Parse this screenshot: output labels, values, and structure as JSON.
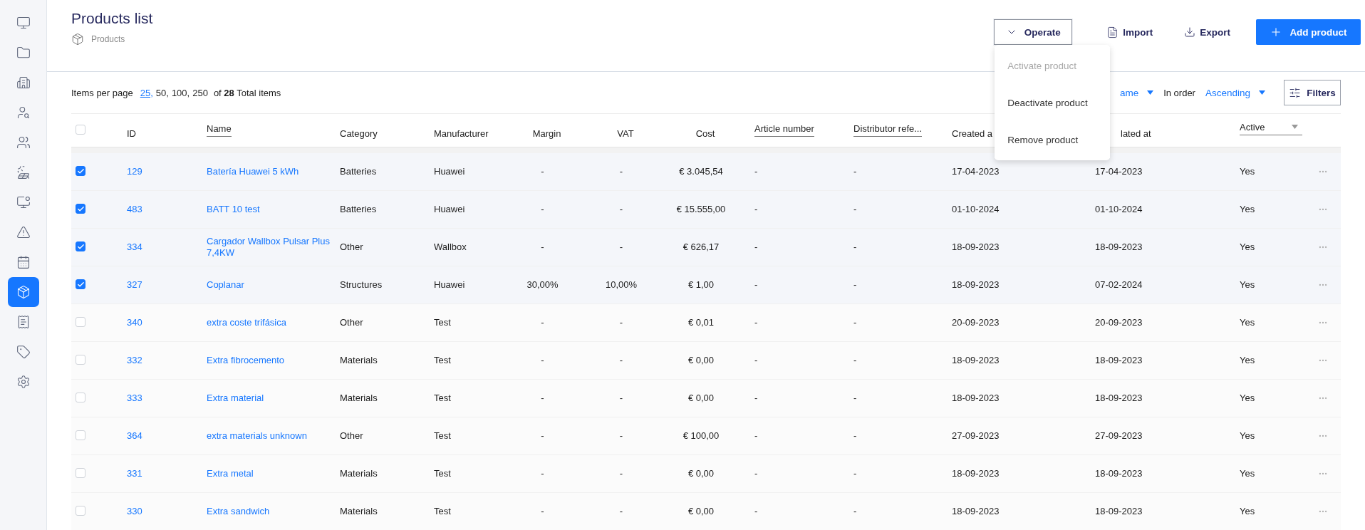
{
  "sidebar": {
    "items": [
      {
        "selected": false
      },
      {
        "selected": false
      },
      {
        "selected": false
      },
      {
        "selected": false
      },
      {
        "selected": false
      },
      {
        "selected": false
      },
      {
        "selected": false
      },
      {
        "selected": false
      },
      {
        "selected": false
      },
      {
        "selected": true
      },
      {
        "selected": false
      },
      {
        "selected": false
      },
      {
        "selected": false
      }
    ]
  },
  "header": {
    "title": "Products list",
    "breadcrumb": "Products",
    "operate": {
      "label": "Operate",
      "expanded": true,
      "menu": [
        {
          "label": "Activate product",
          "disabled": true
        },
        {
          "label": "Deactivate product",
          "disabled": false
        },
        {
          "label": "Remove product",
          "disabled": false
        }
      ]
    },
    "import": "Import",
    "export": "Export",
    "add": "Add product"
  },
  "toolbar": {
    "items_per_page_label": "Items per page",
    "page_sizes": [
      {
        "label": "25,",
        "selected": true
      },
      {
        "label": "50,",
        "selected": false
      },
      {
        "label": "100,",
        "selected": false
      },
      {
        "label": "250",
        "selected": false
      }
    ],
    "total": "of **28** Total items",
    "sort_value": "ame",
    "order_label": "In order",
    "order_value": "Ascending",
    "filters": "Filters"
  },
  "table": {
    "all_checked": false,
    "columns": [
      {
        "label": "ID",
        "kind": "plain"
      },
      {
        "label": "Name",
        "kind": "filter"
      },
      {
        "label": "Category",
        "kind": "plain"
      },
      {
        "label": "Manufacturer",
        "kind": "plain"
      },
      {
        "label": "Margin",
        "kind": "centered"
      },
      {
        "label": "VAT",
        "kind": "centered"
      },
      {
        "label": "Cost",
        "kind": "centered"
      },
      {
        "label": "Article number",
        "kind": "filter"
      },
      {
        "label": "Distributor refe...",
        "kind": "filter"
      },
      {
        "label": "Created a",
        "kind": "plain"
      },
      {
        "label": "lated at",
        "kind": "plain"
      },
      {
        "label": "Active",
        "kind": "select"
      }
    ],
    "rows": [
      {
        "selected": true,
        "cells": [
          "129",
          "Batería Huawei 5 kWh",
          "Batteries",
          "Huawei",
          "-",
          "-",
          "€ 3.045,54",
          "-",
          "-",
          "17-04-2023",
          "17-04-2023",
          "Yes"
        ]
      },
      {
        "selected": true,
        "cells": [
          "483",
          "BATT 10 test",
          "Batteries",
          "Huawei",
          "-",
          "-",
          "€ 15.555,00",
          "-",
          "-",
          "01-10-2024",
          "01-10-2024",
          "Yes"
        ]
      },
      {
        "selected": true,
        "cells": [
          "334",
          "Cargador Wallbox Pulsar Plus 7,4KW",
          "Other",
          "Wallbox",
          "-",
          "-",
          "€ 626,17",
          "-",
          "-",
          "18-09-2023",
          "18-09-2023",
          "Yes"
        ]
      },
      {
        "selected": true,
        "cells": [
          "327",
          "Coplanar",
          "Structures",
          "Huawei",
          "30,00%",
          "10,00%",
          "€ 1,00",
          "-",
          "-",
          "18-09-2023",
          "07-02-2024",
          "Yes"
        ]
      },
      {
        "selected": false,
        "cells": [
          "340",
          "extra coste trifásica",
          "Other",
          "Test",
          "-",
          "-",
          "€ 0,01",
          "-",
          "-",
          "20-09-2023",
          "20-09-2023",
          "Yes"
        ]
      },
      {
        "selected": false,
        "cells": [
          "332",
          "Extra fibrocemento",
          "Materials",
          "Test",
          "-",
          "-",
          "€ 0,00",
          "-",
          "-",
          "18-09-2023",
          "18-09-2023",
          "Yes"
        ]
      },
      {
        "selected": false,
        "cells": [
          "333",
          "Extra material",
          "Materials",
          "Test",
          "-",
          "-",
          "€ 0,00",
          "-",
          "-",
          "18-09-2023",
          "18-09-2023",
          "Yes"
        ]
      },
      {
        "selected": false,
        "cells": [
          "364",
          "extra materials unknown",
          "Other",
          "Test",
          "-",
          "-",
          "€ 100,00",
          "-",
          "-",
          "27-09-2023",
          "27-09-2023",
          "Yes"
        ]
      },
      {
        "selected": false,
        "cells": [
          "331",
          "Extra metal",
          "Materials",
          "Test",
          "-",
          "-",
          "€ 0,00",
          "-",
          "-",
          "18-09-2023",
          "18-09-2023",
          "Yes"
        ]
      },
      {
        "selected": false,
        "cells": [
          "330",
          "Extra sandwich",
          "Materials",
          "Test",
          "-",
          "-",
          "€ 0,00",
          "-",
          "-",
          "18-09-2023",
          "18-09-2023",
          "Yes"
        ]
      }
    ]
  }
}
